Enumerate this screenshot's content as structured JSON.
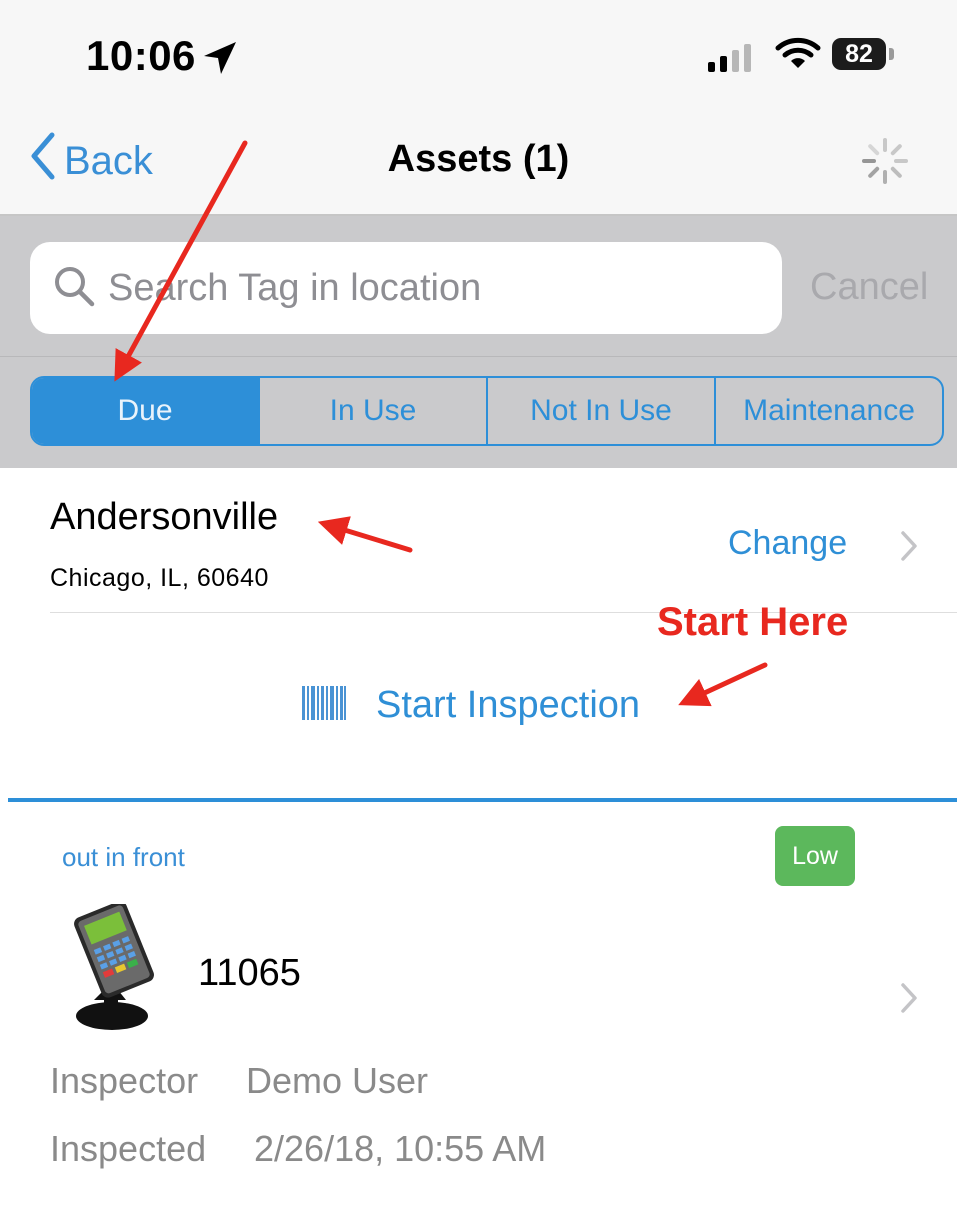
{
  "status_bar": {
    "time": "10:06",
    "battery": "82"
  },
  "nav": {
    "back_label": "Back",
    "title": "Assets (1)"
  },
  "search": {
    "placeholder": "Search Tag in location",
    "cancel_label": "Cancel"
  },
  "tabs": [
    {
      "label": "Due",
      "active": true
    },
    {
      "label": "In Use",
      "active": false
    },
    {
      "label": "Not In Use",
      "active": false
    },
    {
      "label": "Maintenance",
      "active": false
    }
  ],
  "location": {
    "name": "Andersonville",
    "address": "Chicago, IL, 60640",
    "change_label": "Change"
  },
  "annotation": {
    "start_here": "Start Here"
  },
  "start_inspection_label": "Start Inspection",
  "asset": {
    "location_note": "out in front",
    "priority": "Low",
    "tag": "11065",
    "inspector_label": "Inspector",
    "inspector_value": "Demo User",
    "inspected_label": "Inspected",
    "inspected_value": "2/26/18, 10:55 AM"
  },
  "colors": {
    "accent": "#2d8fd8",
    "annotation_red": "#e8281f",
    "badge_green": "#5cb85c"
  }
}
